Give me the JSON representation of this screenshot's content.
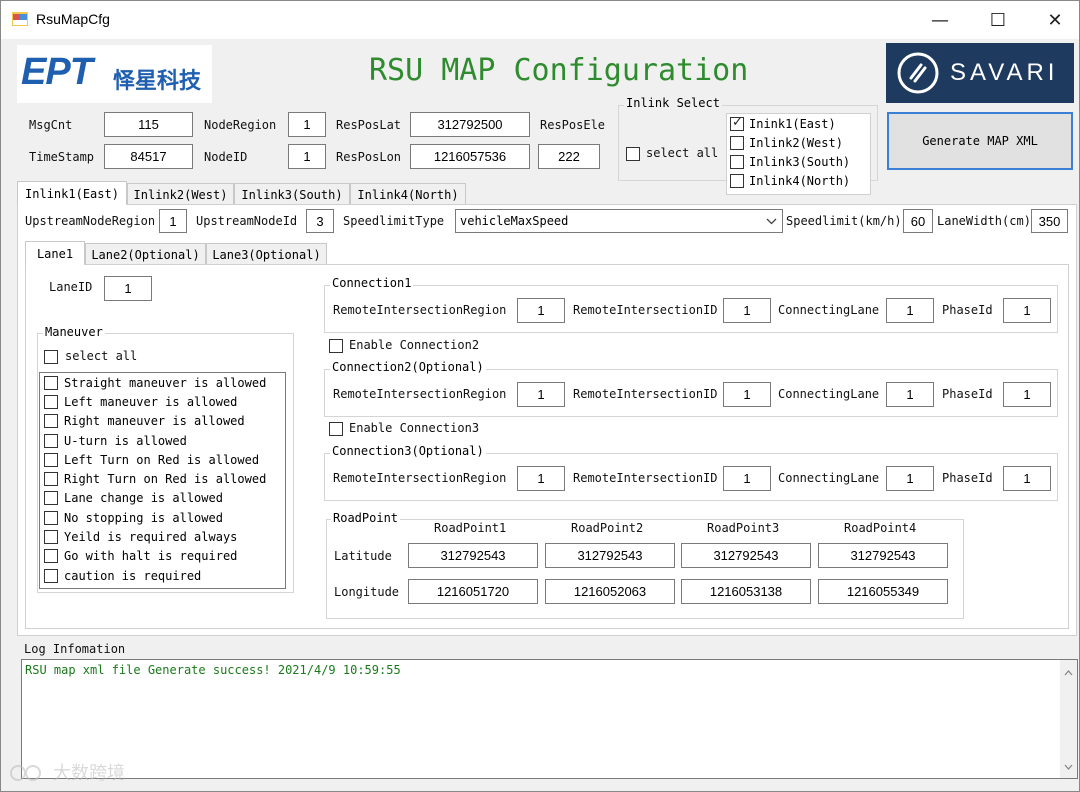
{
  "window": {
    "title": "RsuMapCfg",
    "minimize": "—",
    "maximize": "☐",
    "close": "✕"
  },
  "header": {
    "logo_left_text": "EPT",
    "logo_left_cn": "怿星科技",
    "main_title": "RSU MAP Configuration",
    "logo_right_text": "SAVARI"
  },
  "top_fields": {
    "msgcnt_label": "MsgCnt",
    "msgcnt_value": "115",
    "timestamp_label": "TimeStamp",
    "timestamp_value": "84517",
    "noderegion_label": "NodeRegion",
    "noderegion_value": "1",
    "nodeid_label": "NodeID",
    "nodeid_value": "1",
    "resposlat_label": "ResPosLat",
    "resposlat_value": "312792500",
    "resposlon_label": "ResPosLon",
    "resposlon_value": "1216057536",
    "resposele_label": "ResPosEle",
    "resposele_value": "222"
  },
  "inlink_select": {
    "title": "Inlink Select",
    "select_all": "select all",
    "items": [
      {
        "label": "Inink1(East)",
        "checked": true
      },
      {
        "label": "Inlink2(West)",
        "checked": false
      },
      {
        "label": "Inlink3(South)",
        "checked": false
      },
      {
        "label": "Inlink4(North)",
        "checked": false
      }
    ]
  },
  "generate_button": "Generate MAP XML",
  "inlink_tabs": [
    "Inlink1(East)",
    "Inlink2(West)",
    "Inlink3(South)",
    "Inlink4(North)"
  ],
  "inlink_panel": {
    "upstream_region_label": "UpstreamNodeRegion",
    "upstream_region_value": "1",
    "upstream_id_label": "UpstreamNodeId",
    "upstream_id_value": "3",
    "speedlimit_type_label": "SpeedlimitType",
    "speedlimit_type_value": "vehicleMaxSpeed",
    "speedlimit_label": "Speedlimit(km/h)",
    "speedlimit_value": "60",
    "lanewidth_label": "LaneWidth(cm)",
    "lanewidth_value": "350"
  },
  "lane_tabs": [
    "Lane1",
    "Lane2(Optional)",
    "Lane3(Optional)"
  ],
  "lane": {
    "laneid_label": "LaneID",
    "laneid_value": "1",
    "maneuver_title": "Maneuver",
    "select_all": "select all",
    "maneuvers": [
      "Straight maneuver is allowed",
      "Left maneuver is allowed",
      "Right maneuver is allowed",
      "U-turn is allowed",
      "Left Turn on Red is allowed",
      "Right Turn on Red is allowed",
      "Lane change is allowed",
      "No stopping is allowed",
      "Yeild is required always",
      "Go with halt is required",
      "caution is required"
    ]
  },
  "connections": {
    "field_labels": [
      "RemoteIntersectionRegion",
      "RemoteIntersectionID",
      "ConnectingLane",
      "PhaseId"
    ],
    "conn1": {
      "title": "Connection1",
      "values": [
        "1",
        "1",
        "1",
        "1"
      ]
    },
    "enable2": "Enable Connection2",
    "conn2": {
      "title": "Connection2(Optional)",
      "values": [
        "1",
        "1",
        "1",
        "1"
      ]
    },
    "enable3": "Enable Connection3",
    "conn3": {
      "title": "Connection3(Optional)",
      "values": [
        "1",
        "1",
        "1",
        "1"
      ]
    }
  },
  "roadpoint": {
    "title": "RoadPoint",
    "headers": [
      "RoadPoint1",
      "RoadPoint2",
      "RoadPoint3",
      "RoadPoint4"
    ],
    "latitude_label": "Latitude",
    "longitude_label": "Longitude",
    "latitudes": [
      "312792543",
      "312792543",
      "312792543",
      "312792543"
    ],
    "longitudes": [
      "1216051720",
      "1216052063",
      "1216053138",
      "1216055349"
    ]
  },
  "log": {
    "title": "Log Infomation",
    "message": "RSU map xml file Generate success! 2021/4/9 10:59:55"
  },
  "watermark": "大数跨境",
  "colors": {
    "title_green": "#2e8b2e",
    "log_green": "#1a7a1a",
    "savari_bg": "#1e3a5f",
    "ept_blue": "#1f5fb0"
  }
}
